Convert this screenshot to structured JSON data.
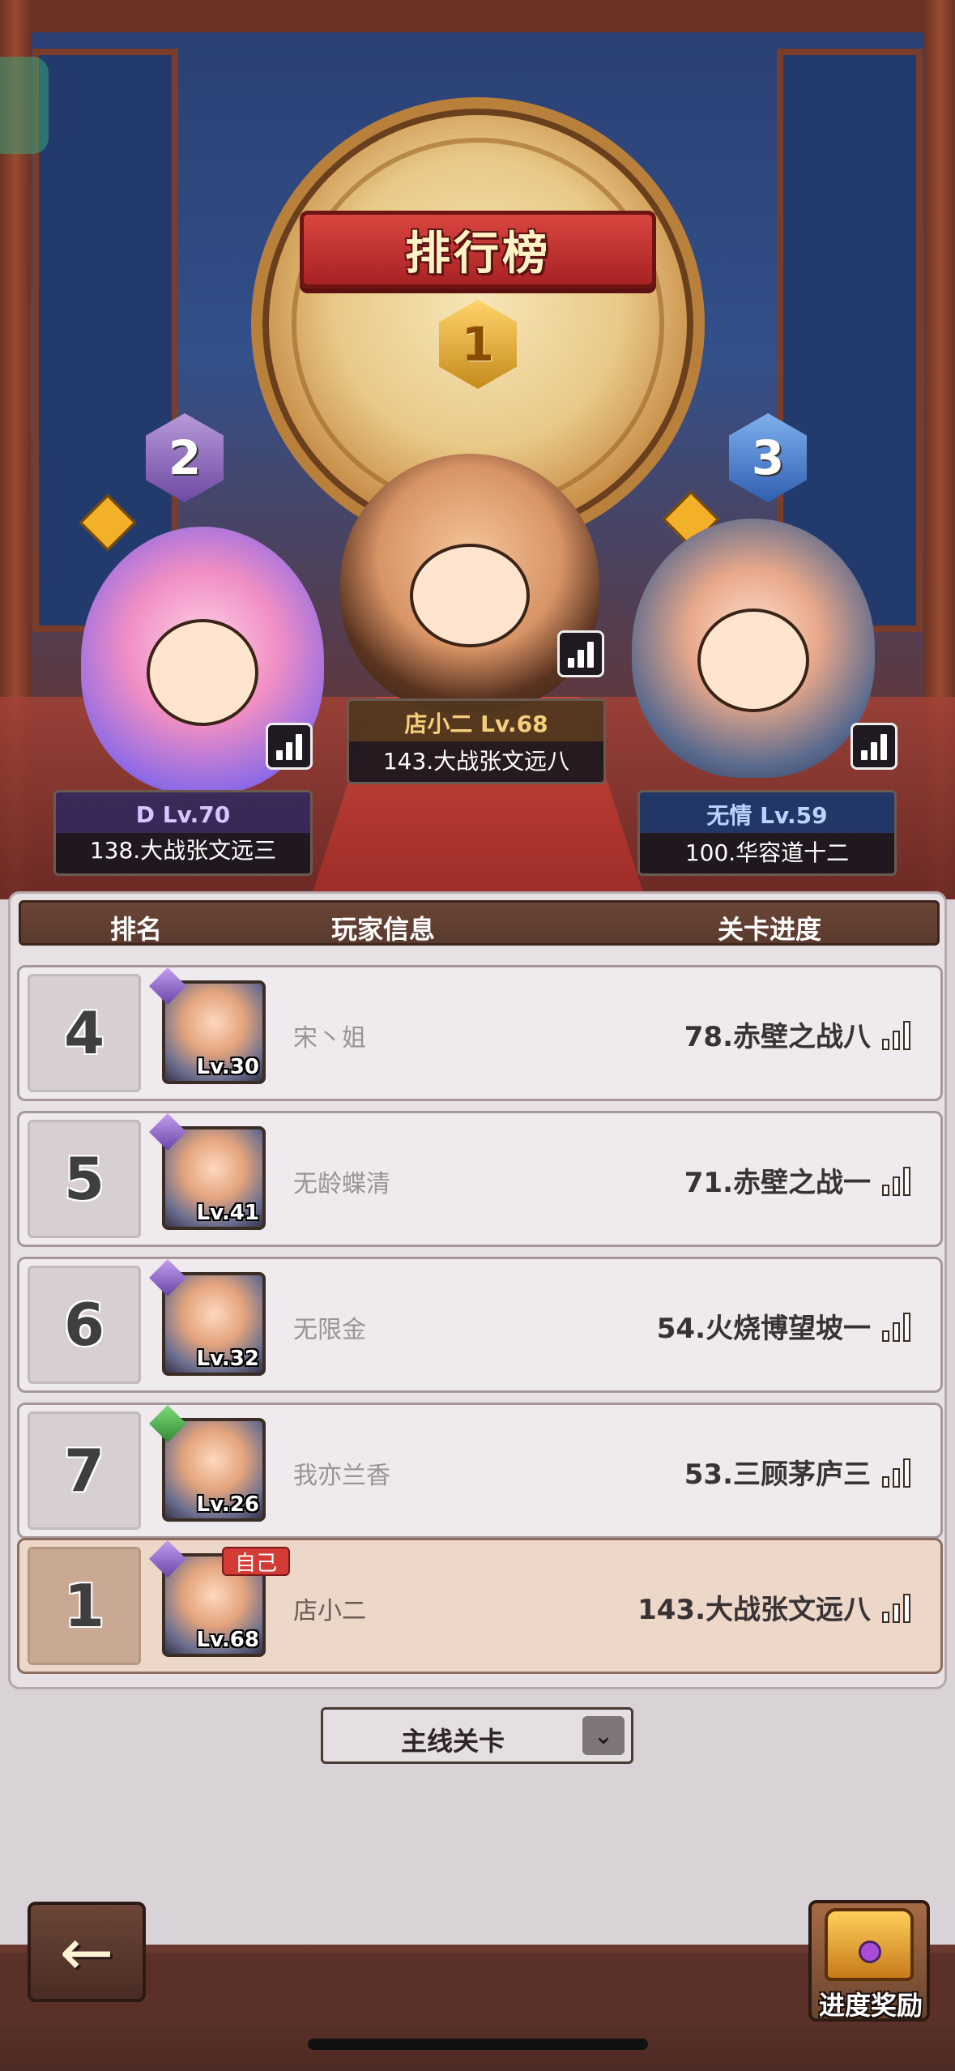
{
  "title": "排行榜",
  "top3": [
    {
      "rank": "1",
      "name": "店小二 Lv.68",
      "stage": "143.大战张文远八"
    },
    {
      "rank": "2",
      "name": "D Lv.70",
      "stage": "138.大战张文远三"
    },
    {
      "rank": "3",
      "name": "无情 Lv.59",
      "stage": "100.华容道十二"
    }
  ],
  "header": {
    "rank": "排名",
    "info": "玩家信息",
    "progress": "关卡进度"
  },
  "rows": [
    {
      "rank": "4",
      "level": "Lv.30",
      "name": "宋丶姐",
      "progress": "78.赤壁之战八"
    },
    {
      "rank": "5",
      "level": "Lv.41",
      "name": "无龄蝶清",
      "progress": "71.赤壁之战一"
    },
    {
      "rank": "6",
      "level": "Lv.32",
      "name": "无限金",
      "progress": "54.火烧博望坡一"
    },
    {
      "rank": "7",
      "level": "Lv.26",
      "name": "我亦兰香",
      "progress": "53.三顾茅庐三"
    }
  ],
  "self": {
    "rank": "1",
    "level": "Lv.68",
    "tag": "自己",
    "name": "店小二",
    "progress": "143.大战张文远八"
  },
  "dropdown": {
    "label": "主线关卡"
  },
  "bottom": {
    "back_icon": "back-arrow-icon",
    "reward_label": "进度奖励"
  }
}
